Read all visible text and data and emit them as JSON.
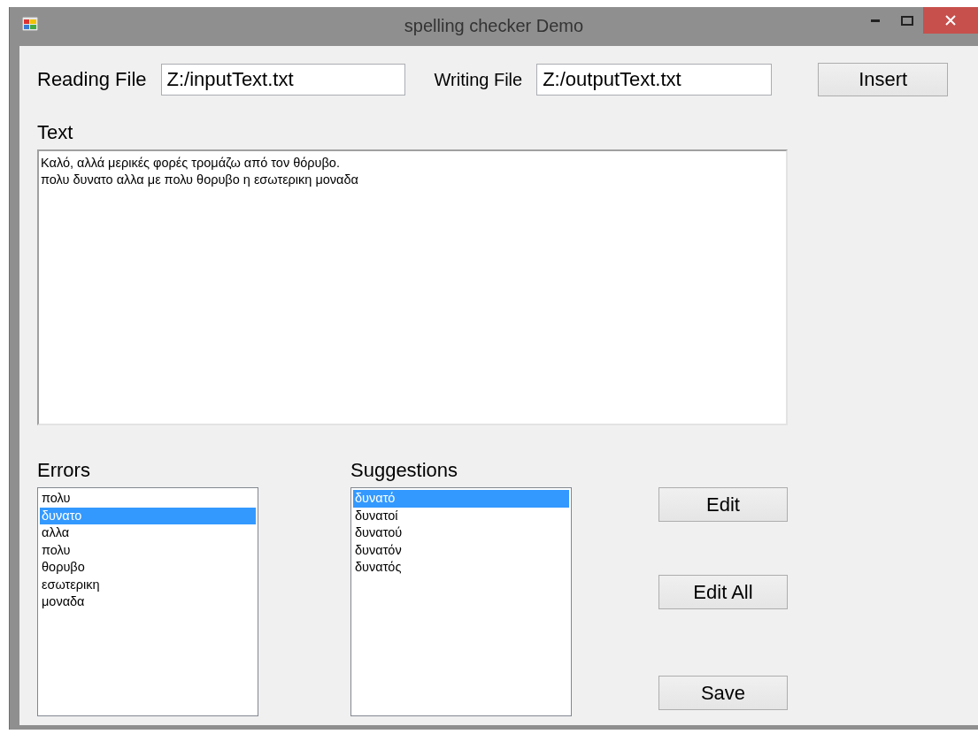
{
  "window": {
    "title": "spelling checker Demo"
  },
  "reading_file": {
    "label": "Reading File",
    "value": "Z:/inputText.txt"
  },
  "writing_file": {
    "label": "Writing File",
    "value": "Z:/outputText.txt"
  },
  "insert_button": "Insert",
  "text": {
    "label": "Text",
    "lines": [
      "Καλό, αλλά μερικές φορές τρομάζω από τον θόρυβο.",
      "πολυ δυνατο αλλα με πολυ θορυβο η εσωτερικη μοναδα"
    ]
  },
  "errors": {
    "label": "Errors",
    "items": [
      {
        "text": "πολυ",
        "selected": false
      },
      {
        "text": "δυνατο",
        "selected": true
      },
      {
        "text": "αλλα",
        "selected": false
      },
      {
        "text": "πολυ",
        "selected": false
      },
      {
        "text": "θορυβο",
        "selected": false
      },
      {
        "text": "εσωτερικη",
        "selected": false
      },
      {
        "text": "μοναδα",
        "selected": false
      }
    ]
  },
  "suggestions": {
    "label": "Suggestions",
    "items": [
      {
        "text": "δυνατό",
        "selected": true
      },
      {
        "text": "δυνατοί",
        "selected": false
      },
      {
        "text": "δυνατού",
        "selected": false
      },
      {
        "text": "δυνατόν",
        "selected": false
      },
      {
        "text": "δυνατός",
        "selected": false
      }
    ]
  },
  "buttons": [
    "Edit",
    "Edit All",
    "Save"
  ]
}
